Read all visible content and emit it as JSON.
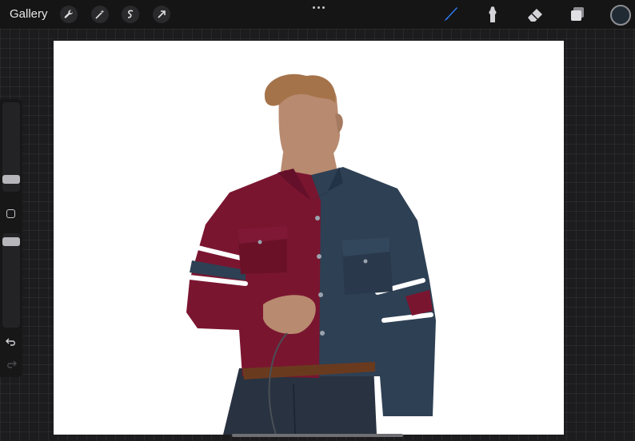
{
  "topbar": {
    "gallery_label": "Gallery",
    "left_tools": [
      "wrench-icon",
      "magic-wand-icon",
      "selection-icon",
      "transform-arrow-icon"
    ],
    "right_tools": [
      "brush-icon",
      "smudge-icon",
      "eraser-icon",
      "layers-icon"
    ],
    "active_tool": "brush-icon",
    "accent_color": "#2f7cf6",
    "current_color": "#1f2a33"
  },
  "sidebar": {
    "controls": [
      "brush-size-slider",
      "modify-button",
      "opacity-slider",
      "undo-icon",
      "redo-icon"
    ]
  },
  "artwork": {
    "palette": {
      "shirt_red": "#7a1530",
      "shirt_blue": "#2e4054",
      "skin": "#b88a6f",
      "hair": "#a5734a",
      "stripe": "#ffffff",
      "jeans": "#283240",
      "belt": "#6a3a1f"
    }
  }
}
